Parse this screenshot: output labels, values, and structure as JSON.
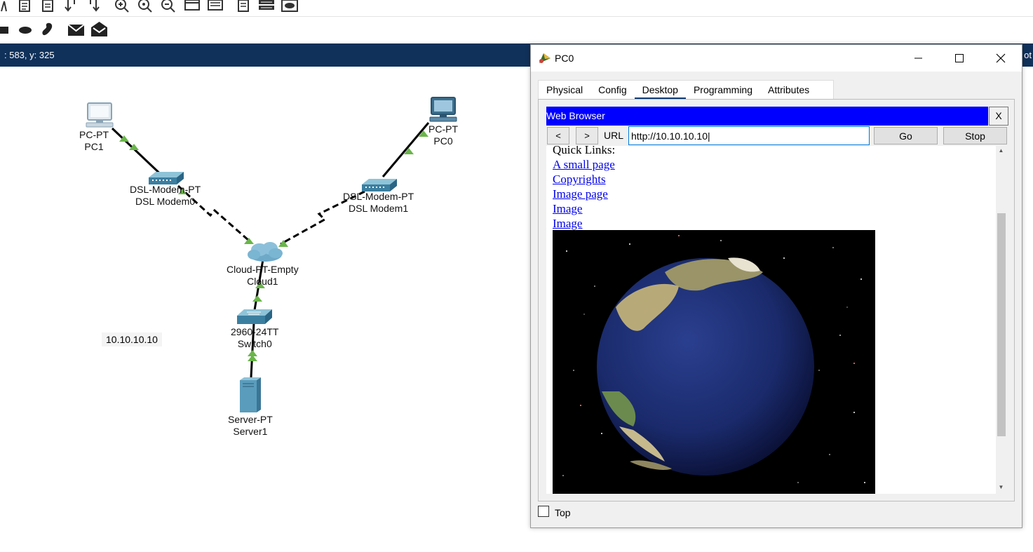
{
  "toolbar": {
    "row1_icons": [
      "text-tool-icon",
      "notes-icon",
      "inspect-icon",
      "pdu-add-icon",
      "pdu-complex-icon",
      "zoom-in-icon",
      "zoom-reset-icon",
      "zoom-out-icon",
      "rectangle-draw-icon",
      "palette-icon",
      "custom-device-icon",
      "network-info-icon",
      "cloud-icon"
    ],
    "row2_icons": [
      "rectangle-icon",
      "ellipse-icon",
      "freeform-icon",
      "simple-pdu-icon",
      "complex-pdu-icon"
    ]
  },
  "statusbar": {
    "coordinates": ": 583, y: 325",
    "right_text": "ot"
  },
  "topology": {
    "devices": [
      {
        "id": "pc1",
        "model": "PC-PT",
        "name": "PC1"
      },
      {
        "id": "pc0",
        "model": "PC-PT",
        "name": "PC0"
      },
      {
        "id": "modem0",
        "model": "DSL-Modem-PT",
        "name": "DSL Modem0"
      },
      {
        "id": "modem1",
        "model": "DSL-Modem-PT",
        "name": "DSL Modem1"
      },
      {
        "id": "cloud1",
        "model": "Cloud-PT-Empty",
        "name": "Cloud1"
      },
      {
        "id": "switch0",
        "model": "2960-24TT",
        "name": "Switch0"
      },
      {
        "id": "server1",
        "model": "Server-PT",
        "name": "Server1"
      }
    ],
    "note": "10.10.10.10",
    "link_status_color": "#6ab54a"
  },
  "window": {
    "title": "PC0",
    "controls": {
      "minimize": "minimize-icon",
      "maximize": "maximize-icon",
      "close": "close-icon"
    },
    "tabs": [
      {
        "label": "Physical",
        "active": false
      },
      {
        "label": "Config",
        "active": false
      },
      {
        "label": "Desktop",
        "active": true
      },
      {
        "label": "Programming",
        "active": false
      },
      {
        "label": "Attributes",
        "active": false
      }
    ],
    "top_checkbox": {
      "label": "Top",
      "checked": false
    }
  },
  "browser": {
    "title": "Web Browser",
    "close_label": "X",
    "back_label": "<",
    "forward_label": ">",
    "url_label": "URL",
    "url_value": "http://10.10.10.10",
    "go_label": "Go",
    "stop_label": "Stop",
    "title_color": "#0000ff",
    "page": {
      "heading": "Quick Links:",
      "links": [
        "A small page",
        "Copyrights",
        "Image page",
        "Image",
        "Image"
      ],
      "image": "earth-image"
    }
  }
}
